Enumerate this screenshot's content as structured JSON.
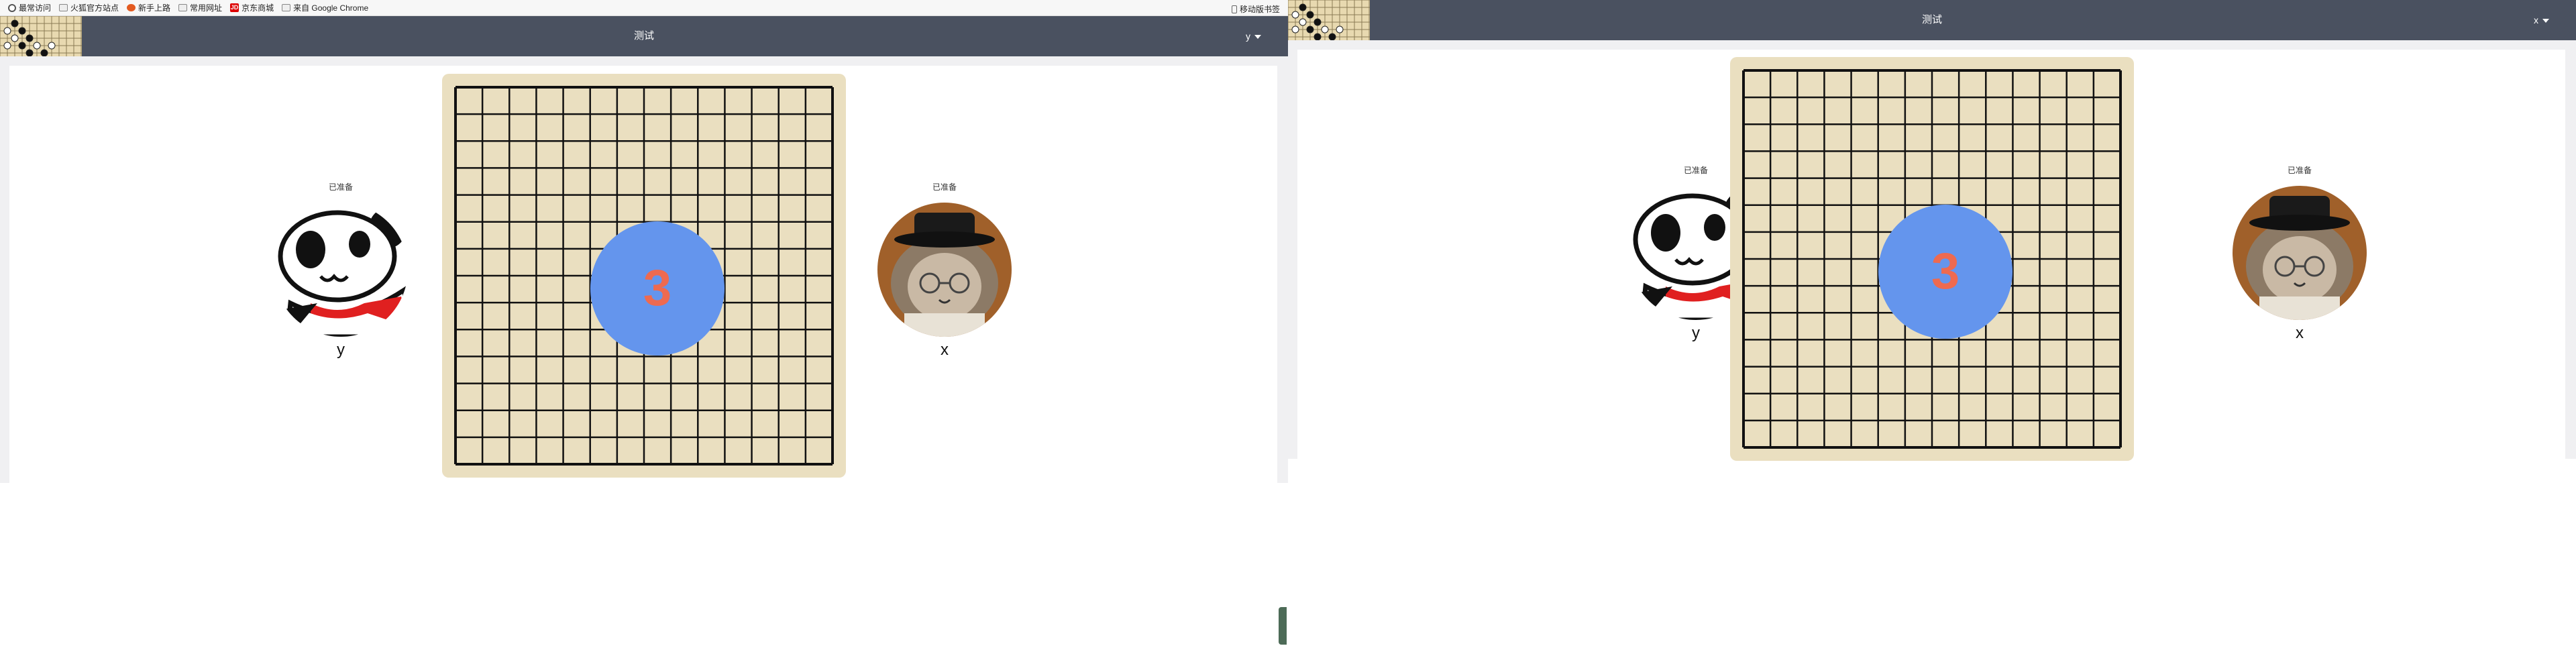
{
  "bookmarks": [
    {
      "label": "最常访问",
      "icon": "gear-icon"
    },
    {
      "label": "火狐官方站点",
      "icon": "folder-icon"
    },
    {
      "label": "新手上路",
      "icon": "firefox-icon"
    },
    {
      "label": "常用网址",
      "icon": "folder-icon"
    },
    {
      "label": "京东商城",
      "icon": "jd-icon"
    },
    {
      "label": "来自 Google Chrome",
      "icon": "folder-icon"
    }
  ],
  "mobile_bookmarks": "移动版书签",
  "left_window": {
    "title": "测试",
    "user": "y",
    "countdown": "3",
    "players": [
      {
        "status": "已准备",
        "name": "y",
        "avatar": "panda-avatar"
      },
      {
        "status": "已准备",
        "name": "x",
        "avatar": "cat-avatar"
      }
    ]
  },
  "right_window": {
    "title": "测试",
    "user": "x",
    "countdown": "3",
    "players": [
      {
        "status": "已准备",
        "name": "y",
        "avatar": "panda-avatar"
      },
      {
        "status": "已准备",
        "name": "x",
        "avatar": "cat-avatar"
      }
    ]
  },
  "board": {
    "lines": 15,
    "background": "#eadfc0",
    "countdown_bg": "#6495ed",
    "countdown_color": "#ee6a50",
    "navbar_color": "#4a5160"
  }
}
